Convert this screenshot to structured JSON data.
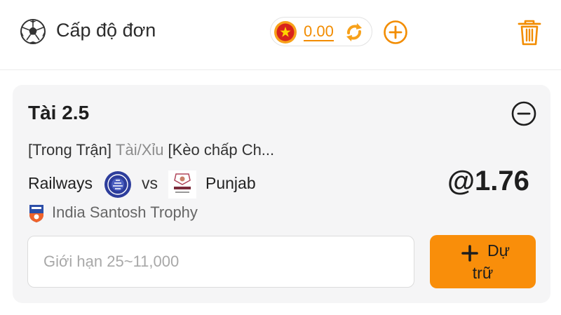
{
  "header": {
    "title": "Cấp độ đơn",
    "balance": "0.00",
    "icons": [
      "soccer-ball-icon",
      "vietnam-flag-icon",
      "refresh-icon",
      "add-circle-icon",
      "trash-icon"
    ]
  },
  "bet": {
    "title": "Tài 2.5",
    "market_phase": "[Trong Trận]",
    "market_type": "Tài/Xỉu",
    "market_detail": "[Kèo chấp Ch...",
    "home_team": "Railways",
    "vs": "vs",
    "away_team": "Punjab",
    "odds": "@1.76",
    "league": "India Santosh Trophy",
    "remove_icon": "minus-circle-icon"
  },
  "stake": {
    "placeholder": "Giới hạn 25~11,000",
    "value": ""
  },
  "reserve_button": {
    "line1": "Dự",
    "line2": "trữ",
    "icon": "plus-icon"
  },
  "colors": {
    "accent": "#f98e0a",
    "card_bg": "#f5f5f6",
    "muted_text": "#8c8c8c"
  }
}
